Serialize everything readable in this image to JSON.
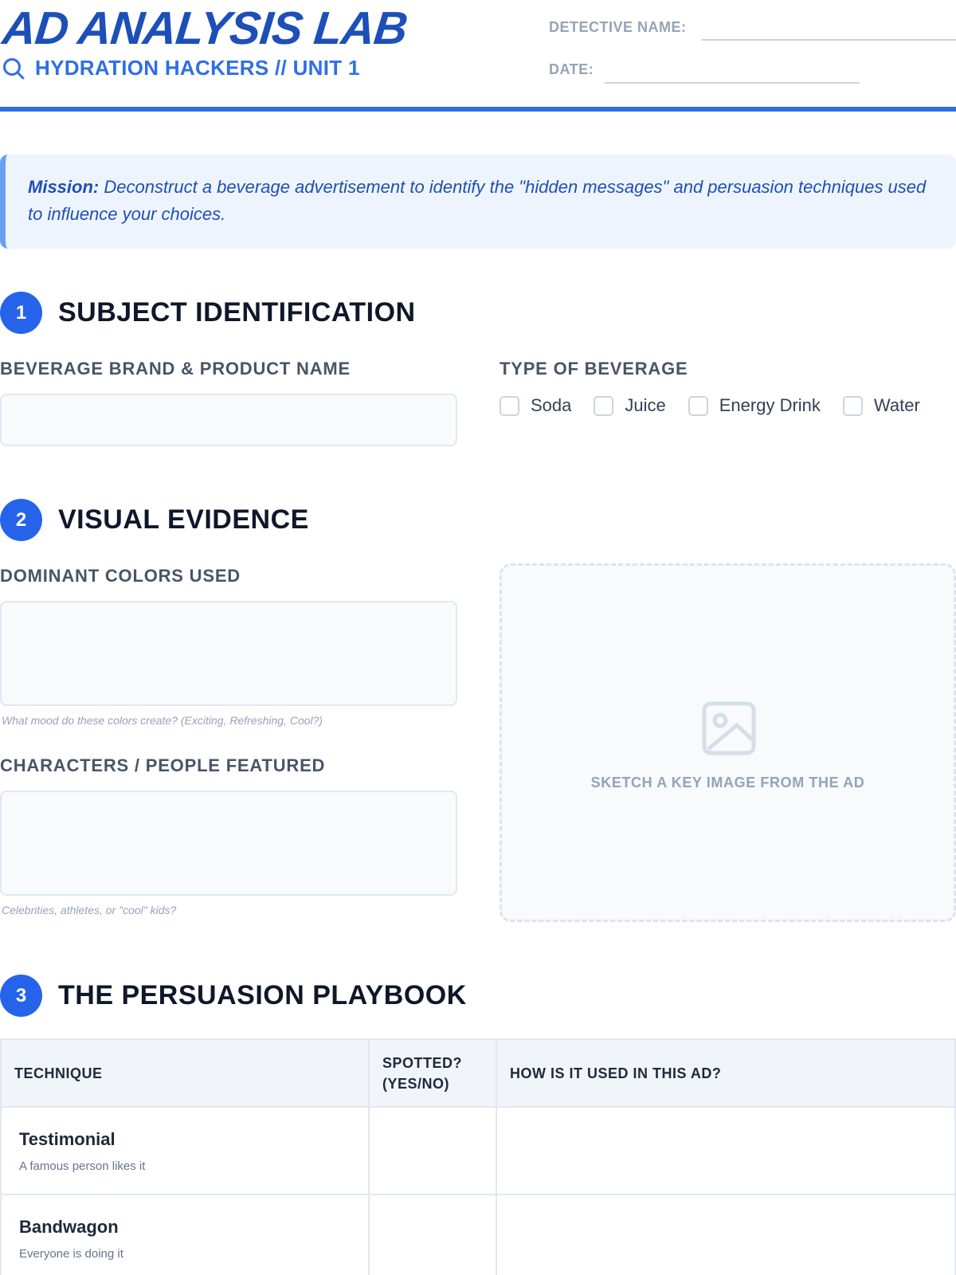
{
  "header": {
    "title": "AD ANALYSIS LAB",
    "subtitle": "HYDRATION HACKERS // UNIT 1",
    "detective_label": "DETECTIVE NAME:",
    "date_label": "DATE:"
  },
  "mission": {
    "lead": "Mission:",
    "text": " Deconstruct a beverage advertisement to identify the \"hidden messages\" and persuasion techniques used to influence your choices."
  },
  "section1": {
    "number": "1",
    "title": "SUBJECT IDENTIFICATION",
    "brand_label": "BEVERAGE BRAND & PRODUCT NAME",
    "type_label": "TYPE OF BEVERAGE",
    "options": [
      "Soda",
      "Juice",
      "Energy Drink",
      "Water"
    ]
  },
  "section2": {
    "number": "2",
    "title": "VISUAL EVIDENCE",
    "colors_label": "DOMINANT COLORS USED",
    "colors_hint": "What mood do these colors create? (Exciting, Refreshing, Cool?)",
    "characters_label": "CHARACTERS / PEOPLE FEATURED",
    "characters_hint": "Celebrities, athletes, or \"cool\" kids?",
    "sketch_label": "SKETCH A KEY IMAGE FROM THE AD"
  },
  "section3": {
    "number": "3",
    "title": "THE PERSUASION PLAYBOOK",
    "columns": [
      "TECHNIQUE",
      "SPOTTED? (YES/NO)",
      "HOW IS IT USED IN THIS AD?"
    ],
    "rows": [
      {
        "name": "Testimonial",
        "desc": "A famous person likes it"
      },
      {
        "name": "Bandwagon",
        "desc": "Everyone is doing it"
      }
    ]
  },
  "colors": {
    "accent": "#2563eb",
    "title": "#1d4fb8",
    "mission_bg": "#eef4fd"
  }
}
